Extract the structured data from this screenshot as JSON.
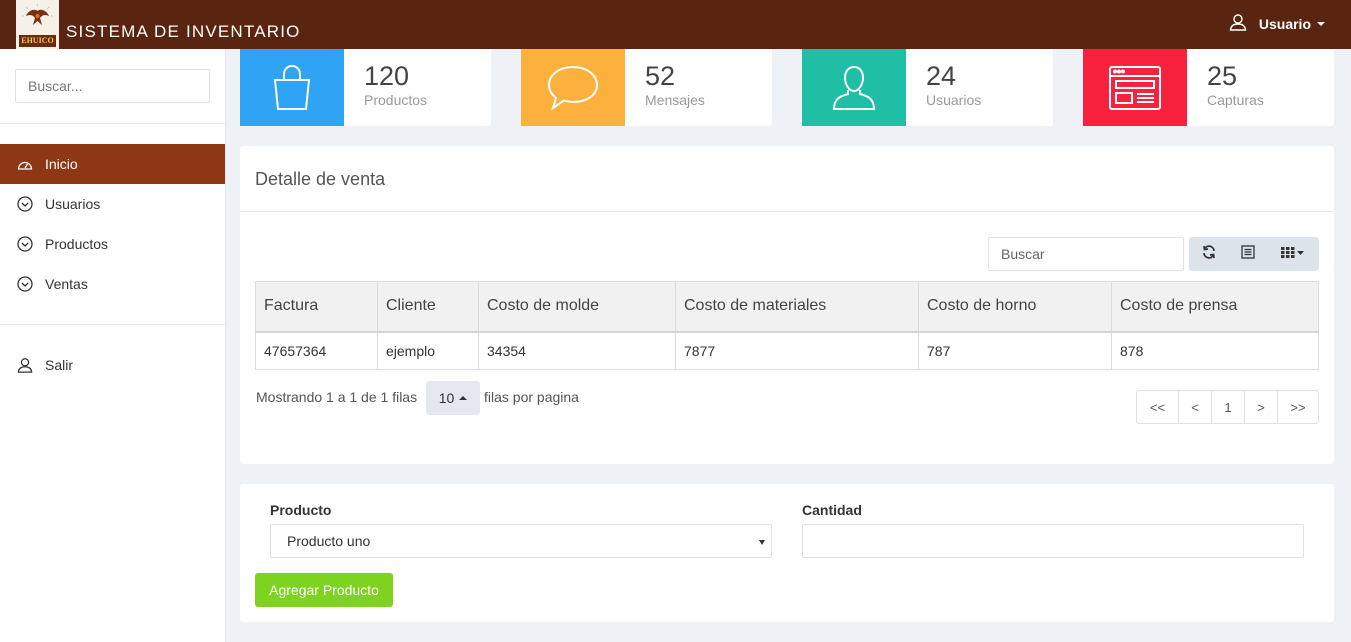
{
  "header": {
    "logo_text": "EHUICO",
    "title": "SISTEMA DE INVENTARIO",
    "user_label": "Usuario"
  },
  "sidebar": {
    "search_placeholder": "Buscar...",
    "items": [
      {
        "label": "Inicio",
        "icon": "dashboard-icon",
        "active": true
      },
      {
        "label": "Usuarios",
        "icon": "chevron-circle-down-icon"
      },
      {
        "label": "Productos",
        "icon": "chevron-circle-down-icon"
      },
      {
        "label": "Ventas",
        "icon": "chevron-circle-down-icon"
      }
    ],
    "logout": {
      "label": "Salir",
      "icon": "user-icon"
    }
  },
  "stats": [
    {
      "value": "120",
      "label": "Productos",
      "icon": "shopping-bag-icon",
      "color": "#2fa4f5"
    },
    {
      "value": "52",
      "label": "Mensajes",
      "icon": "chat-bubble-icon",
      "color": "#fbb13c"
    },
    {
      "value": "24",
      "label": "Usuarios",
      "icon": "user-icon",
      "color": "#1fbfa5"
    },
    {
      "value": "25",
      "label": "Capturas",
      "icon": "browser-window-icon",
      "color": "#f8223f"
    }
  ],
  "sale_detail": {
    "title": "Detalle de venta",
    "search_placeholder": "Buscar",
    "toolbar_icons": [
      "refresh-icon",
      "list-icon",
      "columns-icon"
    ],
    "columns": [
      "Factura",
      "Cliente",
      "Costo de molde",
      "Costo de materiales",
      "Costo de horno",
      "Costo de prensa"
    ],
    "rows": [
      [
        "47657364",
        "ejemplo",
        "34354",
        "7877",
        "787",
        "878"
      ]
    ],
    "pagination": {
      "info": "Mostrando 1 a 1 de 1 filas",
      "page_size": "10",
      "per_page_label": "filas por pagina",
      "pages": [
        "<<",
        "<",
        "1",
        ">",
        ">>"
      ]
    }
  },
  "form": {
    "product_label": "Producto",
    "product_value": "Producto uno",
    "quantity_label": "Cantidad",
    "quantity_value": "",
    "add_button": "Agregar Producto"
  }
}
